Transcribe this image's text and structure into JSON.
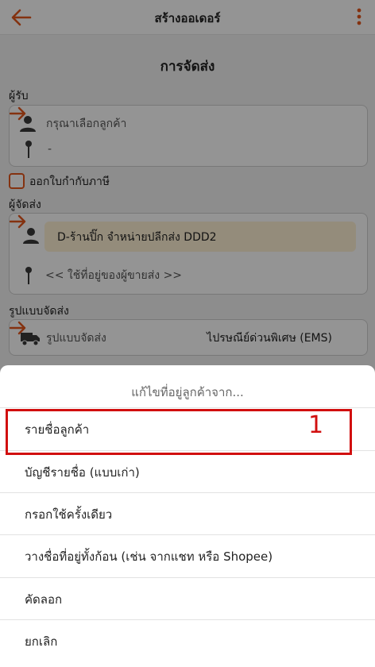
{
  "header": {
    "title": "สร้างออเดอร์"
  },
  "delivery": {
    "section_title": "การจัดส่ง",
    "recipient_label": "ผู้รับ",
    "customer_placeholder": "กรุณาเลือกลูกค้า",
    "customer_address": "-",
    "tax_invoice_label": "ออกใบกำกับภาษี",
    "tax_invoice_checked": false,
    "sender_label": "ผู้จัดส่ง",
    "sender_name": "D-ร้านปิ๊ก จำหน่ายปลีกส่ง DDD2",
    "sender_address": "<< ใช้ที่อยู่ของผู้ขายส่ง >>",
    "shipping_label": "รูปแบบจัดส่ง",
    "shipping_field_label": "รูปแบบจัดส่ง",
    "shipping_value": "ไปรษณีย์ด่วนพิเศษ (EMS)"
  },
  "sheet": {
    "title": "แก้ไขที่อยู่ลูกค้าจาก...",
    "options": [
      "รายชื่อลูกค้า",
      "บัญชีรายชื่อ (แบบเก่า)",
      "กรอกใช้ครั้งเดียว",
      "วางชื่อที่อยู่ทั้งก้อน (เช่น จากแชท หรือ Shopee)",
      "คัดลอก",
      "ยกเลิก"
    ],
    "highlight_number": "1"
  },
  "colors": {
    "accent": "#e4571d",
    "annotation": "#d10f0f",
    "sender_highlight": "#fff1d4"
  },
  "icons": {
    "back": "arrow-left-icon",
    "menu": "kebab-menu-icon",
    "person": "person-icon",
    "pin": "pin-icon",
    "truck": "truck-icon",
    "forward": "arrow-right-icon"
  }
}
